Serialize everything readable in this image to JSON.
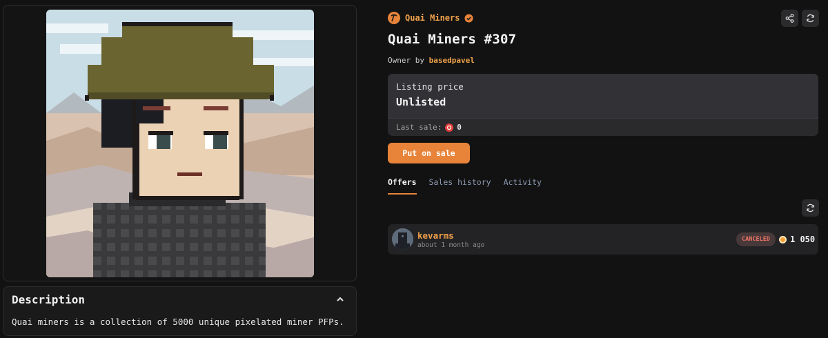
{
  "collection": {
    "name": "Quai Miners",
    "logo_icon": "pickaxe-icon",
    "verified_icon": "verified-badge-icon"
  },
  "nft": {
    "title": "Quai Miners #307",
    "image_alt": "pixel art miner with green flat cap"
  },
  "owner": {
    "prefix": "Owner by",
    "name": "basedpavel"
  },
  "listing": {
    "label": "Listing price",
    "value": "Unlisted",
    "last_sale_label": "Last sale:",
    "last_sale_value": "0"
  },
  "actions": {
    "put_on_sale": "Put on sale",
    "share_icon": "share-icon",
    "refresh_icon": "refresh-icon"
  },
  "tabs": [
    {
      "label": "Offers",
      "active": true
    },
    {
      "label": "Sales history",
      "active": false
    },
    {
      "label": "Activity",
      "active": false
    }
  ],
  "offers": [
    {
      "user": "kevarms",
      "time": "about 1 month ago",
      "status": "CANCELED",
      "amount": "1 050"
    }
  ],
  "description": {
    "title": "Description",
    "text": "Quai miners is a collection of 5000 unique pixelated miner PFPs."
  },
  "colors": {
    "accent": "#e8843a",
    "link": "#f0a24a",
    "bg": "#121212",
    "card": "#2a2a2d",
    "canceled": "#f07466"
  }
}
